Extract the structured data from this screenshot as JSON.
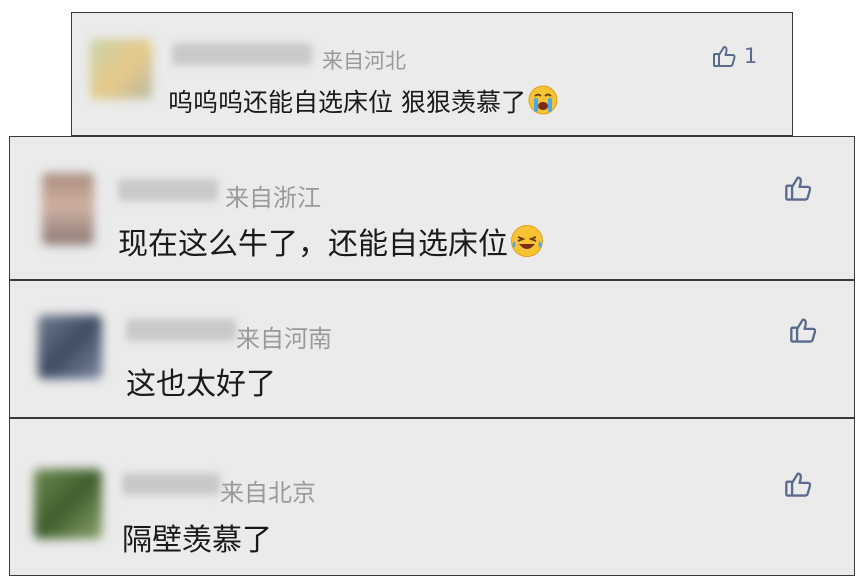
{
  "comments": [
    {
      "region": "来自河北",
      "text": "呜呜呜还能自选床位 狠狠羡慕了",
      "emoji": "loudly-crying-face-icon",
      "likes": "1"
    },
    {
      "region": "来自浙江",
      "text": "现在这么牛了，还能自选床位",
      "emoji": "tears-of-joy-face-icon",
      "likes": ""
    },
    {
      "region": "来自河南",
      "text": "这也太好了",
      "emoji": "",
      "likes": ""
    },
    {
      "region": "来自北京",
      "text": "隔壁羡慕了",
      "emoji": "",
      "likes": ""
    }
  ],
  "colors": {
    "card_bg": "#ebebeb",
    "region_text": "#9a9a9a",
    "like_icon": "#5b6a8c",
    "text": "#1a1a1a"
  }
}
